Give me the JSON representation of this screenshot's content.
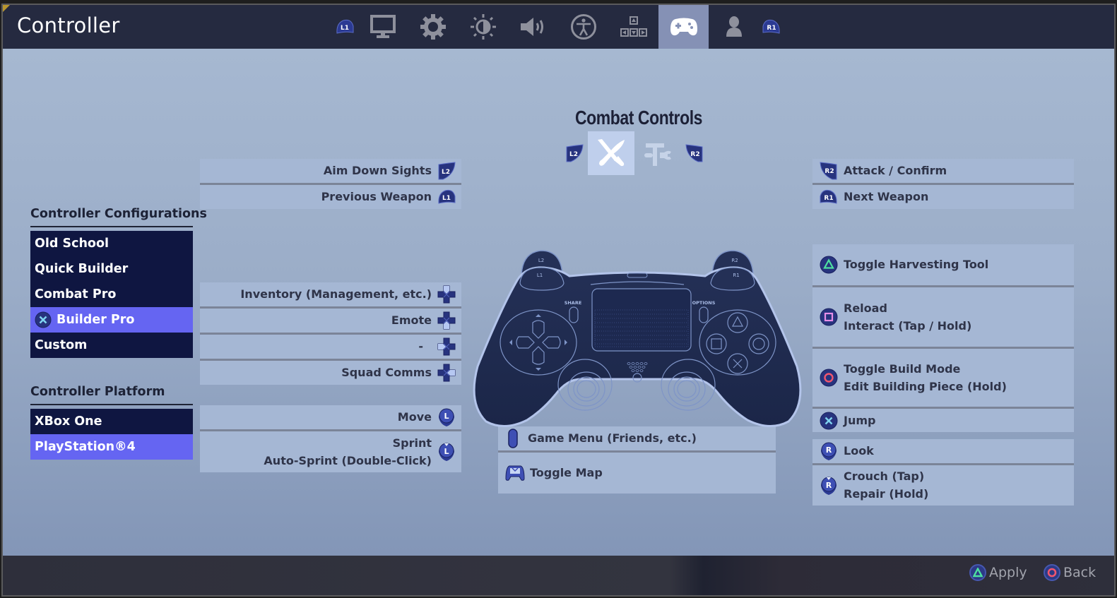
{
  "window": {
    "title": "Controller"
  },
  "tabs": {
    "left_bumper": "L1",
    "right_bumper": "R1",
    "items": [
      {
        "name": "display",
        "icon": "monitor-icon",
        "active": false
      },
      {
        "name": "game",
        "icon": "gear-icon",
        "active": false
      },
      {
        "name": "brightness",
        "icon": "brightness-icon",
        "active": false
      },
      {
        "name": "audio",
        "icon": "speaker-icon",
        "active": false
      },
      {
        "name": "accessibility",
        "icon": "accessibility-icon",
        "active": false
      },
      {
        "name": "input",
        "icon": "arrow-keys-icon",
        "active": false
      },
      {
        "name": "controller",
        "icon": "gamepad-icon",
        "active": true
      },
      {
        "name": "account",
        "icon": "person-icon",
        "active": false
      }
    ]
  },
  "configurations": {
    "title": "Controller Configurations",
    "items": [
      {
        "label": "Old School",
        "selected": false
      },
      {
        "label": "Quick Builder",
        "selected": false
      },
      {
        "label": "Combat Pro",
        "selected": false
      },
      {
        "label": "Builder Pro",
        "selected": true
      },
      {
        "label": "Custom",
        "selected": false
      }
    ]
  },
  "platform": {
    "title": "Controller Platform",
    "items": [
      {
        "label": "XBox One",
        "selected": false
      },
      {
        "label": "PlayStation®4",
        "selected": true
      }
    ]
  },
  "combat": {
    "title": "Combat Controls",
    "left_bumper": "L2",
    "right_bumper": "R2",
    "modes": [
      {
        "name": "combat",
        "icon": "crossed-weapons-icon",
        "active": true
      },
      {
        "name": "build",
        "icon": "hammer-wrench-icon",
        "active": false
      }
    ]
  },
  "controller_labels": {
    "l1": "L1",
    "l2": "L2",
    "r1": "R1",
    "r2": "R2",
    "share": "SHARE",
    "options": "OPTIONS"
  },
  "bindings_left": [
    {
      "lines": [
        "Aim Down Sights"
      ],
      "button": "L2"
    },
    {
      "lines": [
        "Previous Weapon"
      ],
      "button": "L1"
    },
    {
      "lines": [
        "Inventory (Management, etc.)"
      ],
      "button": "D-Pad Up"
    },
    {
      "lines": [
        "Emote"
      ],
      "button": "D-Pad Down"
    },
    {
      "lines": [
        "-"
      ],
      "button": "D-Pad Left"
    },
    {
      "lines": [
        "Squad Comms"
      ],
      "button": "D-Pad Right"
    },
    {
      "lines": [
        "Move"
      ],
      "button": "Left Stick"
    },
    {
      "lines": [
        "Sprint",
        "Auto-Sprint (Double-Click)"
      ],
      "button": "L3"
    }
  ],
  "bindings_center": [
    {
      "lines": [
        "Game Menu (Friends, etc.)"
      ],
      "button": "Options"
    },
    {
      "lines": [
        "Toggle Map"
      ],
      "button": "Touchpad"
    }
  ],
  "bindings_right": [
    {
      "lines": [
        "Attack / Confirm"
      ],
      "button": "R2"
    },
    {
      "lines": [
        "Next Weapon"
      ],
      "button": "R1"
    },
    {
      "lines": [
        "Toggle Harvesting Tool"
      ],
      "button": "Triangle"
    },
    {
      "lines": [
        "Reload",
        "Interact (Tap / Hold)"
      ],
      "button": "Square"
    },
    {
      "lines": [
        "Toggle Build Mode",
        "Edit Building Piece (Hold)"
      ],
      "button": "Circle"
    },
    {
      "lines": [
        "Jump"
      ],
      "button": "Cross"
    },
    {
      "lines": [
        "Look"
      ],
      "button": "Right Stick"
    },
    {
      "lines": [
        "Crouch (Tap)",
        "Repair (Hold)"
      ],
      "button": "R3"
    }
  ],
  "footer": {
    "apply_label": "Apply",
    "back_label": "Back"
  },
  "colors": {
    "accent_selected": "#6565f2",
    "list_bg": "#0f1641",
    "triangle": "#4ee0a0",
    "square": "#e88ee8",
    "circle": "#f0566e",
    "cross": "#7fd4f0"
  }
}
